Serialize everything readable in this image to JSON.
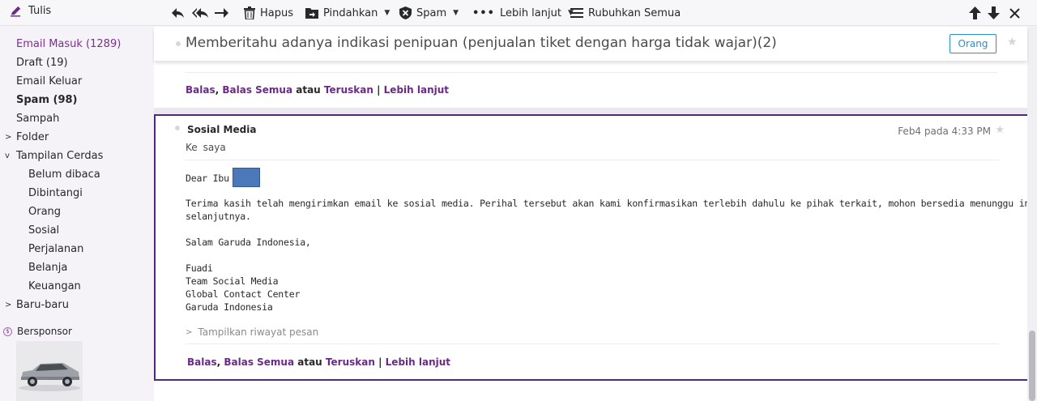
{
  "toolbar": {
    "compose": "Tulis",
    "delete": "Hapus",
    "move": "Pindahkan",
    "spam": "Spam",
    "more": "Lebih lanjut",
    "collapse_all": "Rubuhkan Semua"
  },
  "sidebar": {
    "items": [
      {
        "label": "Email Masuk (1289)"
      },
      {
        "label": "Draft (19)"
      },
      {
        "label": "Email Keluar"
      },
      {
        "label": "Spam (98)"
      },
      {
        "label": "Sampah"
      },
      {
        "label": "Folder"
      },
      {
        "label": "Tampilan Cerdas"
      },
      {
        "label": "Belum dibaca"
      },
      {
        "label": "Dibintangi"
      },
      {
        "label": "Orang"
      },
      {
        "label": "Sosial"
      },
      {
        "label": "Perjalanan"
      },
      {
        "label": "Belanja"
      },
      {
        "label": "Keuangan"
      },
      {
        "label": "Baru-baru"
      }
    ],
    "sponsored": "Bersponsor"
  },
  "conversation": {
    "subject": "Memberitahu adanya indikasi penipuan (penjualan tiket dengan harga tidak wajar)(2)",
    "tag": "Orang"
  },
  "actions": {
    "reply": "Balas",
    "reply_all": "Balas Semua",
    "or": "atau",
    "forward": "Teruskan",
    "separator": "|",
    "more": "Lebih lanjut"
  },
  "message": {
    "sender": "Sosial Media",
    "date": "Feb4 pada 4:33 PM",
    "to_label": "Ke",
    "to_value": "saya",
    "greeting": "Dear Ibu T",
    "body_line1": "Terima kasih telah mengirimkan email ke sosial media. Perihal tersebut akan kami konfirmasikan terlebih dahulu ke pihak terkait, mohon bersedia menunggu informasi",
    "body_line2": "selanjutnya.",
    "closing": "Salam Garuda Indonesia,",
    "sig_name": "Fuadi",
    "sig_team": "Team Social Media",
    "sig_center": "Global Contact Center",
    "sig_company": "Garuda Indonesia",
    "show_history": "Tampilkan riwayat pesan"
  },
  "colors": {
    "accent": "#6a2a86",
    "focus_border": "#4a2a86",
    "tag_blue": "#2b8ed0"
  }
}
